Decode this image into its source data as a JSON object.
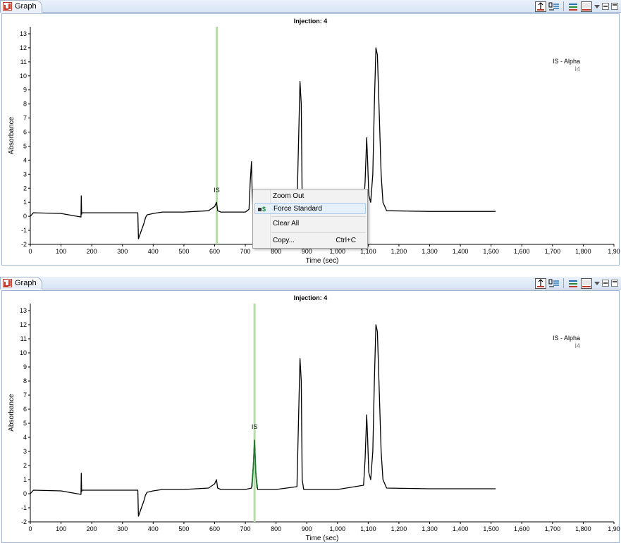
{
  "tab": {
    "label": "Graph"
  },
  "toolbar": {
    "icons": [
      "pin-marker-icon",
      "legend-settings-icon",
      "series-list-icon",
      "background-toggle-icon",
      "view-menu-icon",
      "minimize-icon",
      "maximize-icon"
    ]
  },
  "colors": {
    "tab_bar": "#dde8f6",
    "marker_line": "#b9dcae",
    "trace": "#000000",
    "is_peak_highlight": "#1e7a2e",
    "menu_highlight": "#e5f0fb"
  },
  "context_menu": {
    "items": [
      {
        "label": "Zoom Out",
        "shortcut": ""
      },
      {
        "label": "Force Standard",
        "shortcut": "",
        "icon": "force-standard-icon",
        "icon_text": "$"
      },
      {
        "label": "Clear All",
        "shortcut": ""
      },
      {
        "label": "Copy...",
        "shortcut": "Ctrl+C"
      }
    ]
  },
  "chart_data": [
    {
      "type": "line",
      "title": "Injection: 4",
      "xlabel": "Time (sec)",
      "ylabel": "Absorbance",
      "xlim": [
        0,
        1900
      ],
      "ylim": [
        -2,
        13.5
      ],
      "xticks": [
        0,
        100,
        200,
        300,
        400,
        500,
        600,
        700,
        800,
        900,
        1000,
        1100,
        1200,
        1300,
        1400,
        1500,
        1600,
        1700,
        1800,
        1900
      ],
      "xtick_labels": [
        "0",
        "100",
        "200",
        "300",
        "400",
        "500",
        "600",
        "700",
        "800",
        "900",
        "1,000",
        "1,100",
        "1,200",
        "1,300",
        "1,400",
        "1,500",
        "1,600",
        "1,700",
        "1,800",
        "1,90"
      ],
      "yticks": [
        -2,
        -1,
        0,
        1,
        2,
        3,
        4,
        5,
        6,
        7,
        8,
        9,
        10,
        11,
        12,
        13
      ],
      "legend": {
        "title": "IS - Alpha",
        "entry": "I4",
        "position": "top-right"
      },
      "marker": {
        "x": 607,
        "label": "IS",
        "label_y": 1.7
      },
      "highlight_series": null,
      "series": [
        {
          "x": [
            0,
            10,
            100,
            165,
            166,
            167,
            168,
            350,
            352,
            360,
            370,
            375,
            380,
            400,
            430,
            500,
            580,
            600,
            603,
            606,
            610,
            620,
            700,
            712,
            716,
            720,
            722,
            725,
            730,
            800,
            868,
            873,
            878,
            882,
            885,
            890,
            900,
            1000,
            1085,
            1090,
            1095,
            1098,
            1102,
            1108,
            1115,
            1120,
            1125,
            1130,
            1135,
            1142,
            1148,
            1160,
            1300,
            1400,
            1515
          ],
          "y": [
            0,
            0.25,
            0.2,
            -0.05,
            1.45,
            0.15,
            0.25,
            0.25,
            -1.6,
            -1.1,
            -0.5,
            -0.1,
            0.1,
            0.2,
            0.3,
            0.3,
            0.4,
            0.7,
            0.85,
            1.0,
            0.4,
            0.3,
            0.3,
            0.5,
            2.5,
            3.9,
            2.0,
            0.5,
            0.3,
            0.3,
            0.5,
            5.0,
            9.6,
            8.0,
            1.0,
            0.3,
            0.3,
            0.3,
            0.6,
            2.5,
            5.6,
            4.0,
            1.5,
            1.0,
            3.0,
            8.0,
            12.0,
            11.5,
            8.0,
            3.0,
            1.0,
            0.4,
            0.35,
            0.35,
            0.35
          ]
        }
      ]
    },
    {
      "type": "line",
      "title": "Injection: 4",
      "xlabel": "Time (sec)",
      "ylabel": "Absorbance",
      "xlim": [
        0,
        1900
      ],
      "ylim": [
        -2,
        13.5
      ],
      "xticks": [
        0,
        100,
        200,
        300,
        400,
        500,
        600,
        700,
        800,
        900,
        1000,
        1100,
        1200,
        1300,
        1400,
        1500,
        1600,
        1700,
        1800,
        1900
      ],
      "xtick_labels": [
        "0",
        "100",
        "200",
        "300",
        "400",
        "500",
        "600",
        "700",
        "800",
        "900",
        "1,000",
        "1,100",
        "1,200",
        "1,300",
        "1,400",
        "1,500",
        "1,600",
        "1,700",
        "1,800",
        "1,90"
      ],
      "yticks": [
        -2,
        -1,
        0,
        1,
        2,
        3,
        4,
        5,
        6,
        7,
        8,
        9,
        10,
        11,
        12,
        13
      ],
      "legend": {
        "title": "IS - Alpha",
        "entry": "I4",
        "position": "top-right"
      },
      "marker": {
        "x": 730,
        "label": "IS",
        "label_y": 4.6
      },
      "highlight_series": {
        "x": [
          722,
          726,
          730,
          734,
          738
        ],
        "y": [
          0.5,
          2.0,
          3.8,
          1.5,
          0.4
        ]
      },
      "series": [
        {
          "x": [
            0,
            10,
            100,
            165,
            166,
            167,
            168,
            350,
            352,
            360,
            370,
            375,
            380,
            400,
            430,
            500,
            580,
            600,
            603,
            606,
            610,
            620,
            700,
            720,
            726,
            730,
            734,
            740,
            800,
            868,
            873,
            878,
            882,
            885,
            890,
            900,
            1000,
            1085,
            1090,
            1095,
            1098,
            1102,
            1108,
            1115,
            1120,
            1125,
            1130,
            1135,
            1142,
            1148,
            1160,
            1300,
            1400,
            1515
          ],
          "y": [
            0,
            0.25,
            0.2,
            -0.05,
            1.45,
            0.15,
            0.25,
            0.25,
            -1.6,
            -1.1,
            -0.5,
            -0.1,
            0.1,
            0.2,
            0.3,
            0.3,
            0.4,
            0.7,
            0.85,
            1.0,
            0.4,
            0.3,
            0.3,
            0.4,
            2.0,
            3.8,
            1.5,
            0.3,
            0.3,
            0.5,
            5.0,
            9.6,
            8.0,
            1.0,
            0.3,
            0.3,
            0.3,
            0.6,
            2.5,
            5.6,
            4.0,
            1.5,
            1.0,
            3.0,
            8.0,
            12.0,
            11.5,
            8.0,
            3.0,
            1.0,
            0.4,
            0.35,
            0.35,
            0.35
          ]
        }
      ]
    }
  ]
}
